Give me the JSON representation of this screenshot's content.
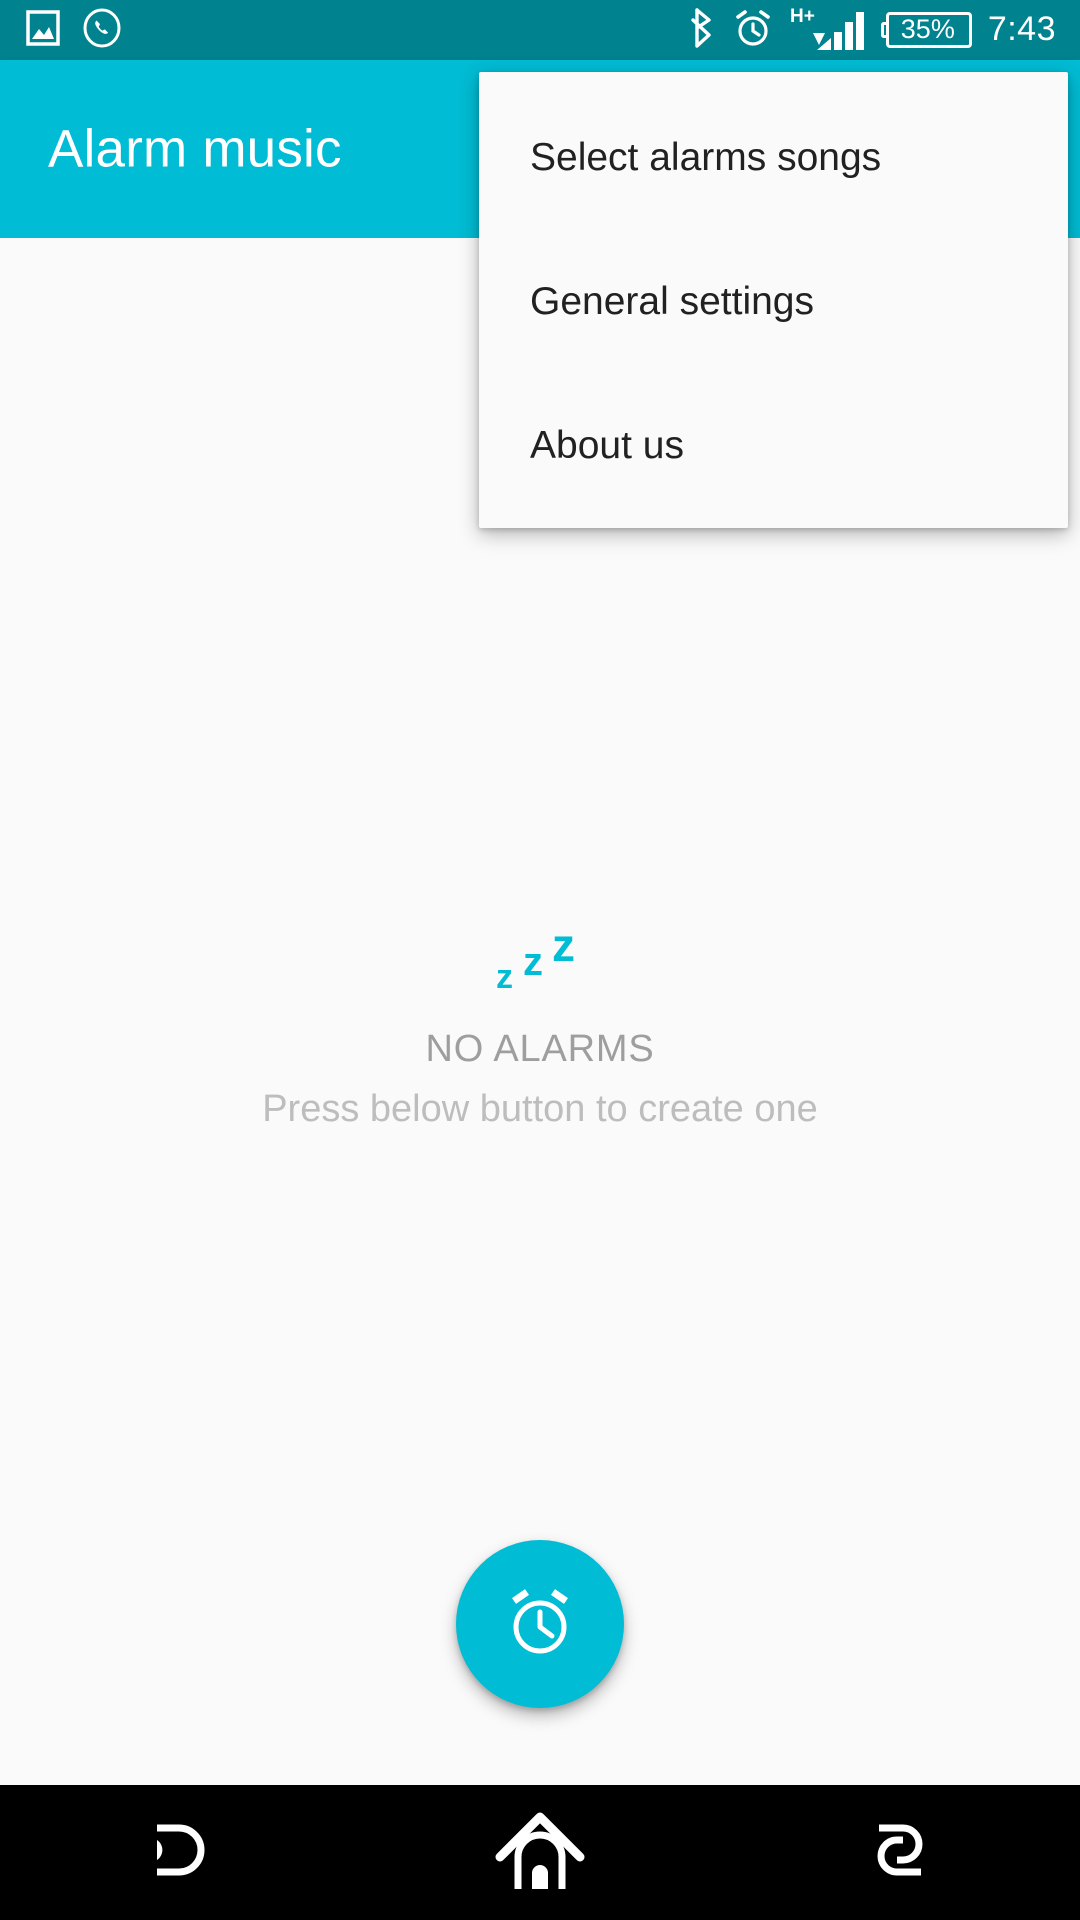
{
  "status_bar": {
    "left_icons": [
      {
        "name": "screenshot-image-icon",
        "label": "image"
      },
      {
        "name": "missed-call-icon",
        "label": "missed call"
      }
    ],
    "right_icons": [
      {
        "name": "bluetooth-icon",
        "label": "bluetooth"
      },
      {
        "name": "alarm-clock-icon",
        "label": "alarm set"
      },
      {
        "name": "mobile-network-icon",
        "label": "signal"
      }
    ],
    "network_type": "H+",
    "battery_percent": "35%",
    "time": "7:43",
    "background_color": "#00838f",
    "foreground_color": "#ffffff"
  },
  "app_bar": {
    "title": "Alarm music",
    "background_color": "#00bcd4",
    "title_color": "#ffffff"
  },
  "overflow_menu": {
    "visible": true,
    "background_color": "#fafafa",
    "items": [
      {
        "label": "Select alarms songs",
        "name": "menu-item-select-alarms-songs"
      },
      {
        "label": "General settings",
        "name": "menu-item-general-settings"
      },
      {
        "label": "About us",
        "name": "menu-item-about-us"
      }
    ]
  },
  "content": {
    "empty_state": {
      "icon": "zzz-sleep-icon",
      "icon_color": "#00bcd4",
      "title": "NO ALARMS",
      "title_color": "#9e9e9e",
      "subtitle": "Press below button to create one",
      "subtitle_color": "#bdbdbd"
    },
    "background_color": "#fafafa"
  },
  "fab": {
    "icon": "alarm-clock-icon",
    "background_color": "#00bcd4",
    "icon_color": "#ffffff",
    "action_label": "Create alarm"
  },
  "nav_bar": {
    "background_color": "#000000",
    "buttons": [
      {
        "label": "Back",
        "name": "nav-back-button"
      },
      {
        "label": "Home",
        "name": "nav-home-button"
      },
      {
        "label": "Recents",
        "name": "nav-recents-button"
      }
    ]
  }
}
